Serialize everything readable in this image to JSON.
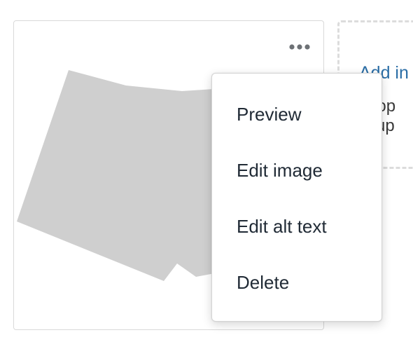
{
  "card": {
    "more_icon": "ellipsis-horizontal-icon",
    "thumbnail_color": "#cfcfcf"
  },
  "dropzone": {
    "add_label": "Add in",
    "hint": "drop\no up",
    "link_color": "#2b6ea6"
  },
  "menu": {
    "items": [
      {
        "label": "Preview"
      },
      {
        "label": "Edit image"
      },
      {
        "label": "Edit alt text"
      },
      {
        "label": "Delete"
      }
    ]
  }
}
